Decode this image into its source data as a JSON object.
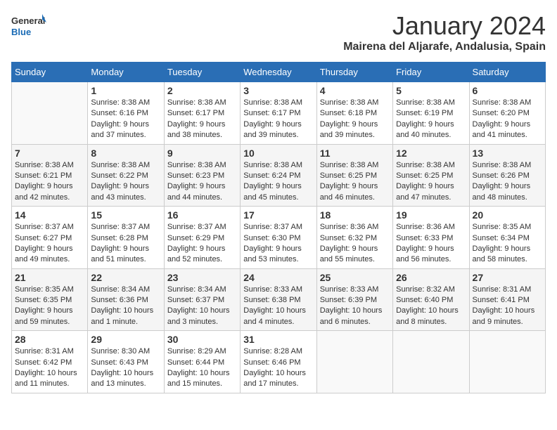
{
  "logo": {
    "line1": "General",
    "line2": "Blue"
  },
  "title": "January 2024",
  "location": "Mairena del Aljarafe, Andalusia, Spain",
  "days_of_week": [
    "Sunday",
    "Monday",
    "Tuesday",
    "Wednesday",
    "Thursday",
    "Friday",
    "Saturday"
  ],
  "weeks": [
    [
      {
        "num": "",
        "info": ""
      },
      {
        "num": "1",
        "info": "Sunrise: 8:38 AM\nSunset: 6:16 PM\nDaylight: 9 hours\nand 37 minutes."
      },
      {
        "num": "2",
        "info": "Sunrise: 8:38 AM\nSunset: 6:17 PM\nDaylight: 9 hours\nand 38 minutes."
      },
      {
        "num": "3",
        "info": "Sunrise: 8:38 AM\nSunset: 6:17 PM\nDaylight: 9 hours\nand 39 minutes."
      },
      {
        "num": "4",
        "info": "Sunrise: 8:38 AM\nSunset: 6:18 PM\nDaylight: 9 hours\nand 39 minutes."
      },
      {
        "num": "5",
        "info": "Sunrise: 8:38 AM\nSunset: 6:19 PM\nDaylight: 9 hours\nand 40 minutes."
      },
      {
        "num": "6",
        "info": "Sunrise: 8:38 AM\nSunset: 6:20 PM\nDaylight: 9 hours\nand 41 minutes."
      }
    ],
    [
      {
        "num": "7",
        "info": "Sunrise: 8:38 AM\nSunset: 6:21 PM\nDaylight: 9 hours\nand 42 minutes."
      },
      {
        "num": "8",
        "info": "Sunrise: 8:38 AM\nSunset: 6:22 PM\nDaylight: 9 hours\nand 43 minutes."
      },
      {
        "num": "9",
        "info": "Sunrise: 8:38 AM\nSunset: 6:23 PM\nDaylight: 9 hours\nand 44 minutes."
      },
      {
        "num": "10",
        "info": "Sunrise: 8:38 AM\nSunset: 6:24 PM\nDaylight: 9 hours\nand 45 minutes."
      },
      {
        "num": "11",
        "info": "Sunrise: 8:38 AM\nSunset: 6:25 PM\nDaylight: 9 hours\nand 46 minutes."
      },
      {
        "num": "12",
        "info": "Sunrise: 8:38 AM\nSunset: 6:25 PM\nDaylight: 9 hours\nand 47 minutes."
      },
      {
        "num": "13",
        "info": "Sunrise: 8:38 AM\nSunset: 6:26 PM\nDaylight: 9 hours\nand 48 minutes."
      }
    ],
    [
      {
        "num": "14",
        "info": "Sunrise: 8:37 AM\nSunset: 6:27 PM\nDaylight: 9 hours\nand 49 minutes."
      },
      {
        "num": "15",
        "info": "Sunrise: 8:37 AM\nSunset: 6:28 PM\nDaylight: 9 hours\nand 51 minutes."
      },
      {
        "num": "16",
        "info": "Sunrise: 8:37 AM\nSunset: 6:29 PM\nDaylight: 9 hours\nand 52 minutes."
      },
      {
        "num": "17",
        "info": "Sunrise: 8:37 AM\nSunset: 6:30 PM\nDaylight: 9 hours\nand 53 minutes."
      },
      {
        "num": "18",
        "info": "Sunrise: 8:36 AM\nSunset: 6:32 PM\nDaylight: 9 hours\nand 55 minutes."
      },
      {
        "num": "19",
        "info": "Sunrise: 8:36 AM\nSunset: 6:33 PM\nDaylight: 9 hours\nand 56 minutes."
      },
      {
        "num": "20",
        "info": "Sunrise: 8:35 AM\nSunset: 6:34 PM\nDaylight: 9 hours\nand 58 minutes."
      }
    ],
    [
      {
        "num": "21",
        "info": "Sunrise: 8:35 AM\nSunset: 6:35 PM\nDaylight: 9 hours\nand 59 minutes."
      },
      {
        "num": "22",
        "info": "Sunrise: 8:34 AM\nSunset: 6:36 PM\nDaylight: 10 hours\nand 1 minute."
      },
      {
        "num": "23",
        "info": "Sunrise: 8:34 AM\nSunset: 6:37 PM\nDaylight: 10 hours\nand 3 minutes."
      },
      {
        "num": "24",
        "info": "Sunrise: 8:33 AM\nSunset: 6:38 PM\nDaylight: 10 hours\nand 4 minutes."
      },
      {
        "num": "25",
        "info": "Sunrise: 8:33 AM\nSunset: 6:39 PM\nDaylight: 10 hours\nand 6 minutes."
      },
      {
        "num": "26",
        "info": "Sunrise: 8:32 AM\nSunset: 6:40 PM\nDaylight: 10 hours\nand 8 minutes."
      },
      {
        "num": "27",
        "info": "Sunrise: 8:31 AM\nSunset: 6:41 PM\nDaylight: 10 hours\nand 9 minutes."
      }
    ],
    [
      {
        "num": "28",
        "info": "Sunrise: 8:31 AM\nSunset: 6:42 PM\nDaylight: 10 hours\nand 11 minutes."
      },
      {
        "num": "29",
        "info": "Sunrise: 8:30 AM\nSunset: 6:43 PM\nDaylight: 10 hours\nand 13 minutes."
      },
      {
        "num": "30",
        "info": "Sunrise: 8:29 AM\nSunset: 6:44 PM\nDaylight: 10 hours\nand 15 minutes."
      },
      {
        "num": "31",
        "info": "Sunrise: 8:28 AM\nSunset: 6:46 PM\nDaylight: 10 hours\nand 17 minutes."
      },
      {
        "num": "",
        "info": ""
      },
      {
        "num": "",
        "info": ""
      },
      {
        "num": "",
        "info": ""
      }
    ]
  ]
}
